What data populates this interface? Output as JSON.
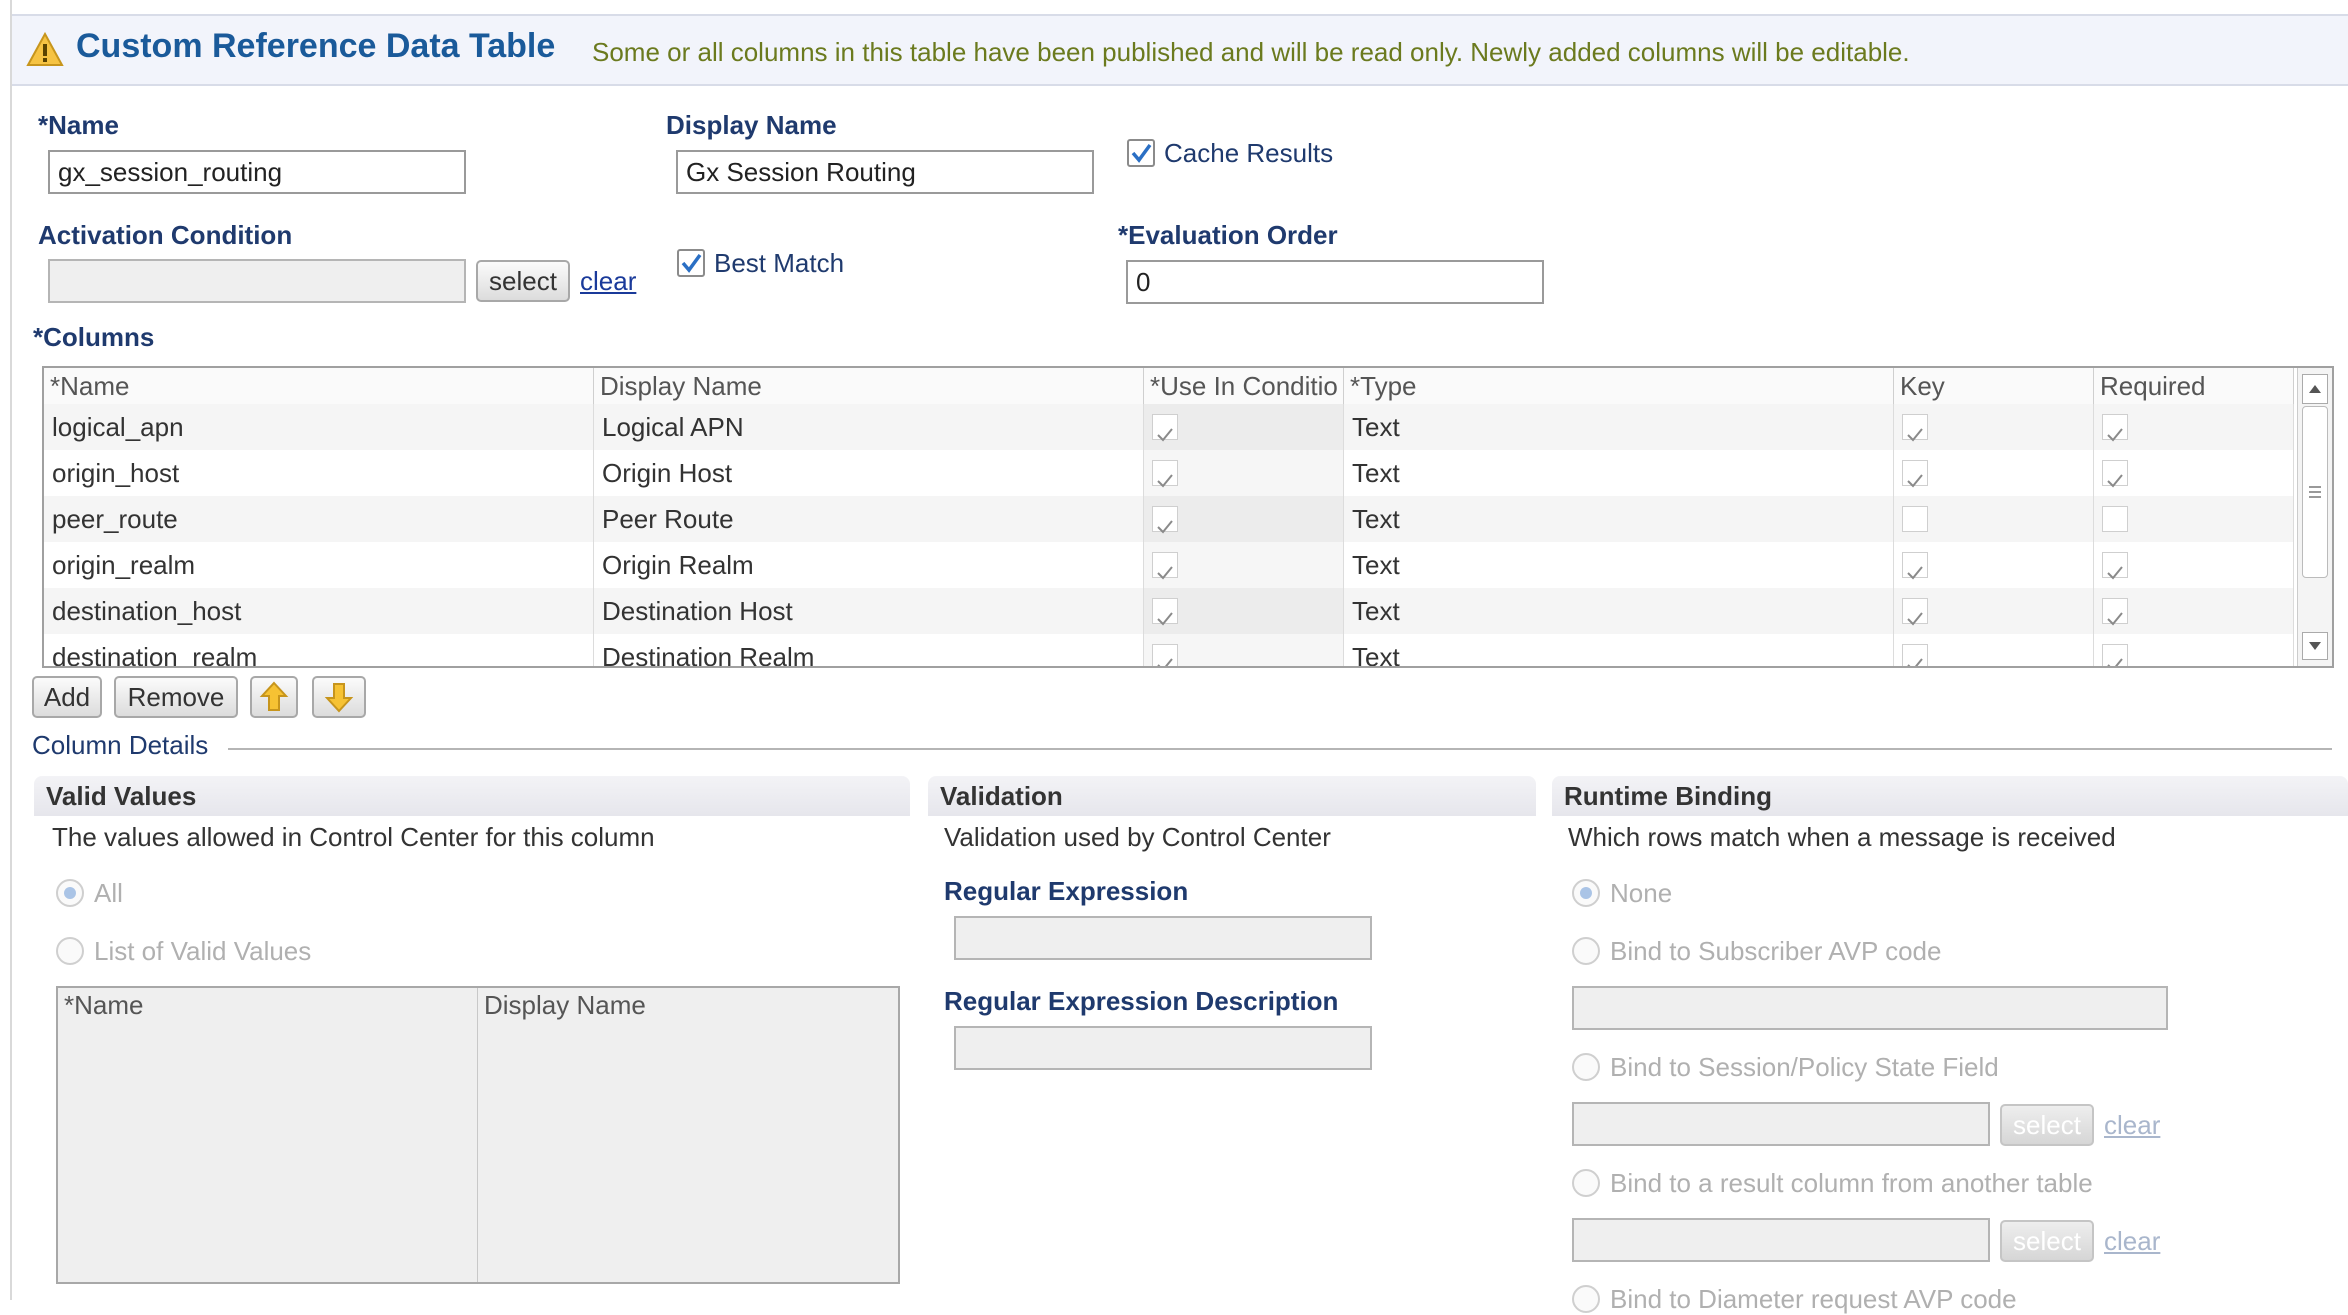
{
  "header": {
    "title": "Custom Reference Data Table",
    "notice": "Some or all columns in this table have been published and will be read only.  Newly added columns will be editable."
  },
  "form": {
    "name_label": "*Name",
    "name_value": "gx_session_routing",
    "display_name_label": "Display Name",
    "display_name_value": "Gx Session Routing",
    "cache_results_label": "Cache Results",
    "cache_results_checked": true,
    "activation_condition_label": "Activation Condition",
    "activation_condition_value": "",
    "select_label": "select",
    "clear_label": "clear",
    "best_match_label": "Best Match",
    "best_match_checked": true,
    "evaluation_order_label": "*Evaluation Order",
    "evaluation_order_value": "0"
  },
  "columns": {
    "label": "*Columns",
    "headers": [
      "*Name",
      "Display Name",
      "*Use In Conditio",
      "*Type",
      "Key",
      "Required"
    ],
    "rows": [
      {
        "name": "logical_apn",
        "display": "Logical APN",
        "use_in_conditions": true,
        "type": "Text",
        "key": true,
        "required": true
      },
      {
        "name": "origin_host",
        "display": "Origin Host",
        "use_in_conditions": true,
        "type": "Text",
        "key": true,
        "required": true
      },
      {
        "name": "peer_route",
        "display": "Peer Route",
        "use_in_conditions": true,
        "type": "Text",
        "key": false,
        "required": false
      },
      {
        "name": "origin_realm",
        "display": "Origin Realm",
        "use_in_conditions": true,
        "type": "Text",
        "key": true,
        "required": true
      },
      {
        "name": "destination_host",
        "display": "Destination Host",
        "use_in_conditions": true,
        "type": "Text",
        "key": true,
        "required": true
      },
      {
        "name": "destination_realm",
        "display": "Destination Realm",
        "use_in_conditions": true,
        "type": "Text",
        "key": true,
        "required": true
      }
    ],
    "add_label": "Add",
    "remove_label": "Remove"
  },
  "column_details": {
    "legend": "Column Details",
    "valid_values": {
      "title": "Valid Values",
      "description": "The values allowed in Control Center for this column",
      "option_all": "All",
      "option_list": "List of Valid Values",
      "table_headers": [
        "*Name",
        "Display Name"
      ]
    },
    "validation": {
      "title": "Validation",
      "description": "Validation used by Control Center",
      "regex_label": "Regular Expression",
      "regex_value": "",
      "regex_desc_label": "Regular Expression Description",
      "regex_desc_value": ""
    },
    "runtime_binding": {
      "title": "Runtime Binding",
      "description": "Which rows match when a message is received",
      "option_none": "None",
      "option_subscriber_avp": "Bind to Subscriber AVP code",
      "option_session_field": "Bind to Session/Policy State Field",
      "option_result_column": "Bind to a result column from another table",
      "option_diameter_avp": "Bind to Diameter request AVP code",
      "select_label": "select",
      "clear_label": "clear"
    }
  },
  "colors": {
    "title": "#1a5a9a",
    "label": "#1f3a6e",
    "notice": "#6b7a1e",
    "check": "#2a6fc4"
  }
}
